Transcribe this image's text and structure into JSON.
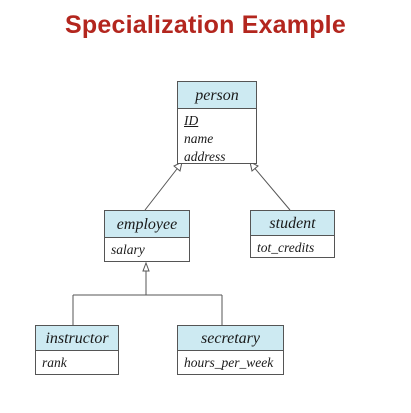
{
  "title": "Specialization Example",
  "entities": {
    "person": {
      "name": "person",
      "attributes": [
        {
          "label": "ID",
          "key": true
        },
        {
          "label": "name",
          "key": false
        },
        {
          "label": "address",
          "key": false
        }
      ]
    },
    "employee": {
      "name": "employee",
      "attributes": [
        {
          "label": "salary",
          "key": false
        }
      ]
    },
    "student": {
      "name": "student",
      "attributes": [
        {
          "label": "tot_credits",
          "key": false
        }
      ]
    },
    "instructor": {
      "name": "instructor",
      "attributes": [
        {
          "label": "rank",
          "key": false
        }
      ]
    },
    "secretary": {
      "name": "secretary",
      "attributes": [
        {
          "label": "hours_per_week",
          "key": false
        }
      ]
    }
  },
  "colors": {
    "title": "#b3261e",
    "entity_header": "#cdeaf2",
    "border": "#555555"
  }
}
